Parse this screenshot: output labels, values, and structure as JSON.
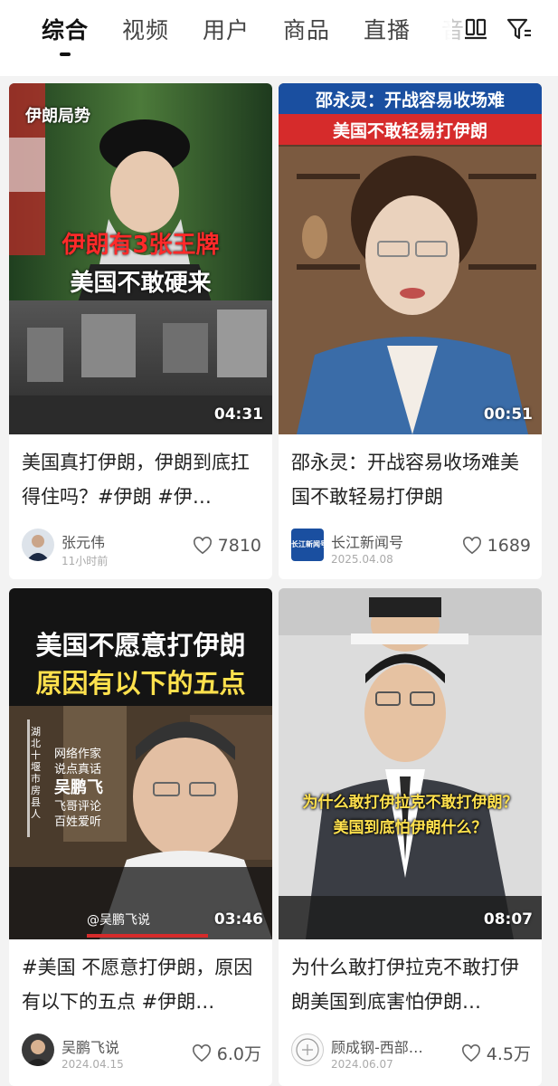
{
  "tabs": [
    "综合",
    "视频",
    "用户",
    "商品",
    "直播",
    "音"
  ],
  "colors": {
    "accent_red": "#e02020",
    "yellow": "#ffe14d",
    "text": "#222222"
  },
  "cards": [
    {
      "overlay": {
        "tag": "伊朗局势",
        "line1": "伊朗有3张王牌",
        "line2": "美国不敢硬来"
      },
      "duration": "04:31",
      "title": "美国真打伊朗，伊朗到底扛得住吗？#伊朗 #伊…",
      "author": "张元伟",
      "date": "11小时前",
      "likes": "7810"
    },
    {
      "overlay": {
        "banner1": "邵永灵：开战容易收场难",
        "banner2": "美国不敢轻易打伊朗"
      },
      "duration": "00:51",
      "title": "邵永灵：开战容易收场难美国不敢轻易打伊朗",
      "author": "长江新闻号",
      "avatar_text": "长江新闻号",
      "date": "2025.04.08",
      "likes": "1689"
    },
    {
      "overlay": {
        "line1": "美国不愿意打伊朗",
        "line2": "原因有以下的五点",
        "side": "湖北十堰市房县人",
        "info1": "网络作家",
        "info2": "说点真话",
        "name": "吴鹏飞",
        "info3": "飞哥评论",
        "info4": "百姓爱听",
        "handle": "@吴鹏飞说"
      },
      "duration": "03:46",
      "title": "#美国 不愿意打伊朗，原因有以下的五点 #伊朗…",
      "author": "吴鹏飞说",
      "date": "2024.04.15",
      "likes": "6.0万"
    },
    {
      "overlay": {
        "line1": "为什么敢打伊拉克不敢打伊朗？",
        "line2": "美国到底怕伊朗什么？"
      },
      "duration": "08:07",
      "title": "为什么敢打伊拉克不敢打伊朗美国到底害怕伊朗…",
      "author": "顾成钢-西部…",
      "date": "2024.06.07",
      "likes": "4.5万"
    }
  ]
}
